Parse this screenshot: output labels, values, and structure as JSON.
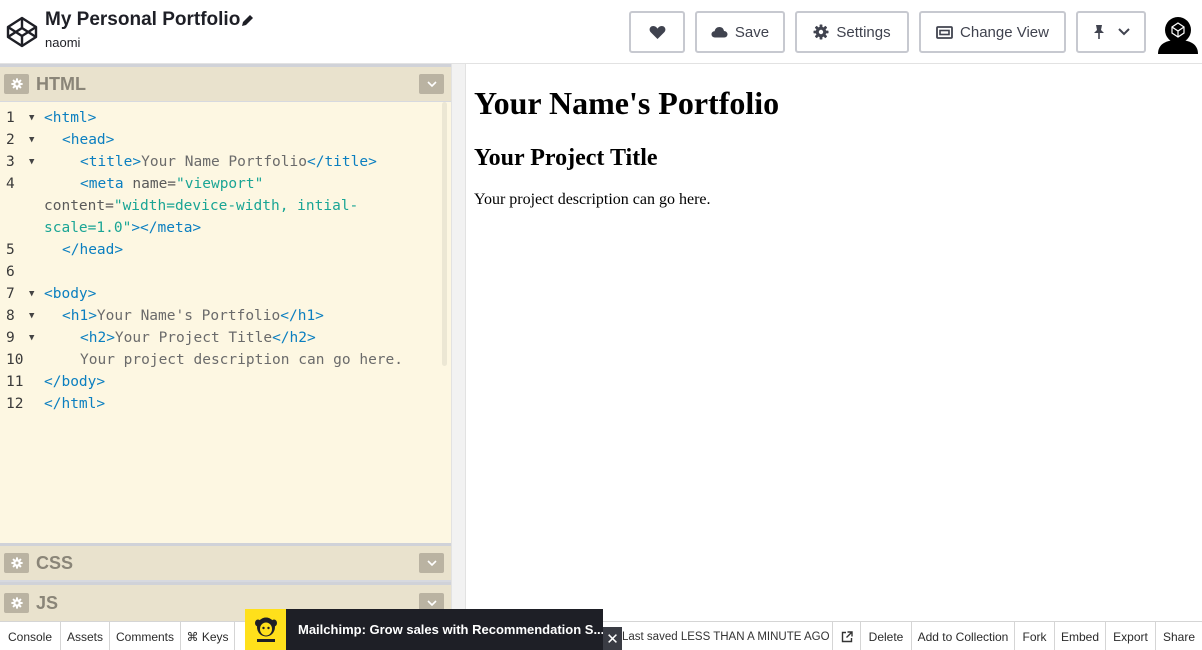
{
  "header": {
    "title": "My Personal Portfolio",
    "owner": "naomi",
    "buttons": {
      "save": "Save",
      "settings": "Settings",
      "change_view": "Change View"
    }
  },
  "panels": {
    "html": "HTML",
    "css": "CSS",
    "js": "JS"
  },
  "code": {
    "line_numbers": [
      "1",
      "2",
      "3",
      "4",
      "5",
      "6",
      "7",
      "8",
      "9",
      "10",
      "11",
      "12"
    ],
    "l1_tag": "<html>",
    "l2_tag": "<head>",
    "l3_open": "<title>",
    "l3_text": "Your Name Portfolio",
    "l3_close": "</title>",
    "l4_open": "<meta",
    "l4_attr": " name=",
    "l4_val": "\"viewport\"",
    "l4b_attr": "content=",
    "l4b_val": "\"width=device-width, intial-",
    "l4c_val": "scale=1.0\"",
    "l4c_close": "></meta>",
    "l5_tag": "</head>",
    "l7_tag": "<body>",
    "l8_open": "<h1>",
    "l8_text": "Your Name's Portfolio",
    "l8_close": "</h1>",
    "l9_open": "<h2>",
    "l9_text": "Your Project Title",
    "l9_close": "</h2>",
    "l10_text": "Your project description can go here.",
    "l11_tag": "</body>",
    "l12_tag": "</html>"
  },
  "preview": {
    "h1": "Your Name's Portfolio",
    "h2": "Your Project Title",
    "p": "Your project description can go here."
  },
  "footer": {
    "console": "Console",
    "assets": "Assets",
    "comments": "Comments",
    "keys": "⌘ Keys",
    "last_saved_prefix": "Last saved",
    "last_saved_value": "LESS THAN A MINUTE AGO",
    "delete": "Delete",
    "add_to_collection": "Add to Collection",
    "fork": "Fork",
    "embed": "Embed",
    "export": "Export",
    "share": "Share"
  },
  "ad": {
    "text": "Mailchimp: Grow sales with Recommendation S...",
    "close": "✕"
  },
  "colors": {
    "panel_header": "#e9e2cd",
    "editor_bg": "#fdf7e2",
    "tag": "#0b7fc0",
    "string": "#1aa595",
    "mailchimp_yellow": "#ffe01b"
  }
}
